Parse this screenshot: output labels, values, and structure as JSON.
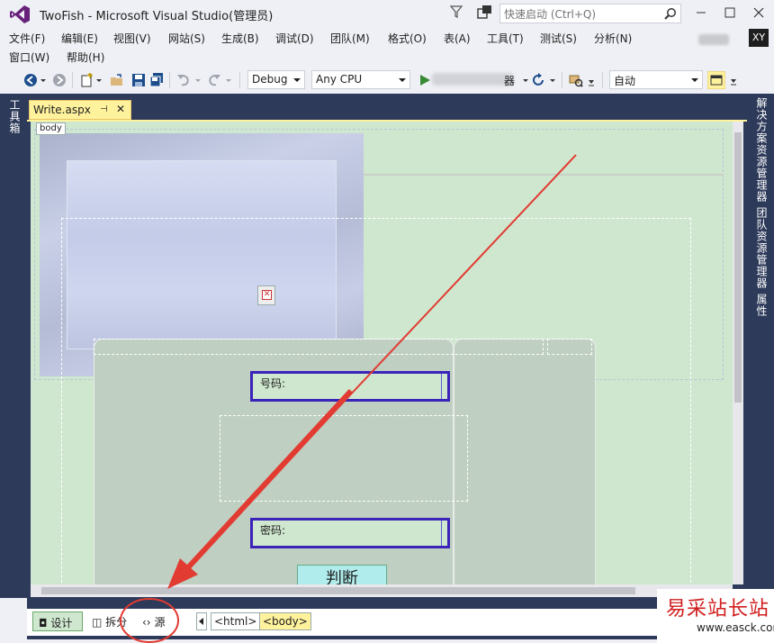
{
  "window": {
    "title": "TwoFish - Microsoft Visual Studio(管理员)",
    "quick_launch_placeholder": "快速启动 (Ctrl+Q)",
    "user_initials": "XY"
  },
  "menu": {
    "items": [
      "文件(F)",
      "编辑(E)",
      "视图(V)",
      "网站(S)",
      "生成(B)",
      "调试(D)",
      "团队(M)",
      "格式(O)",
      "表(A)",
      "工具(T)",
      "测试(S)",
      "分析(N)"
    ],
    "row2": [
      "窗口(W)",
      "帮助(H)"
    ]
  },
  "toolbar": {
    "config": "Debug",
    "platform": "Any CPU",
    "run_suffix": "器",
    "zoom_mode": "自动"
  },
  "side_panels": {
    "left": [
      "工具箱"
    ],
    "right": [
      "解决方案资源管理器",
      "团队资源管理器",
      "属性"
    ]
  },
  "document": {
    "tab_name": "Write.aspx",
    "body_tag": "body",
    "number_label": "号码:",
    "password_label": "密码:",
    "judge_button": "判断"
  },
  "view_bar": {
    "design": "设计",
    "split": "拆分",
    "source": "源",
    "crumb_html": "<html>",
    "crumb_body": "<body>"
  },
  "watermark": {
    "title": "易采站长站",
    "url": "www.easck.com"
  },
  "colors": {
    "annotation_red": "#e23b32",
    "field_border": "#3a25b8",
    "doc_tab": "#fff29d",
    "design_surface": "#cfe7cf"
  }
}
